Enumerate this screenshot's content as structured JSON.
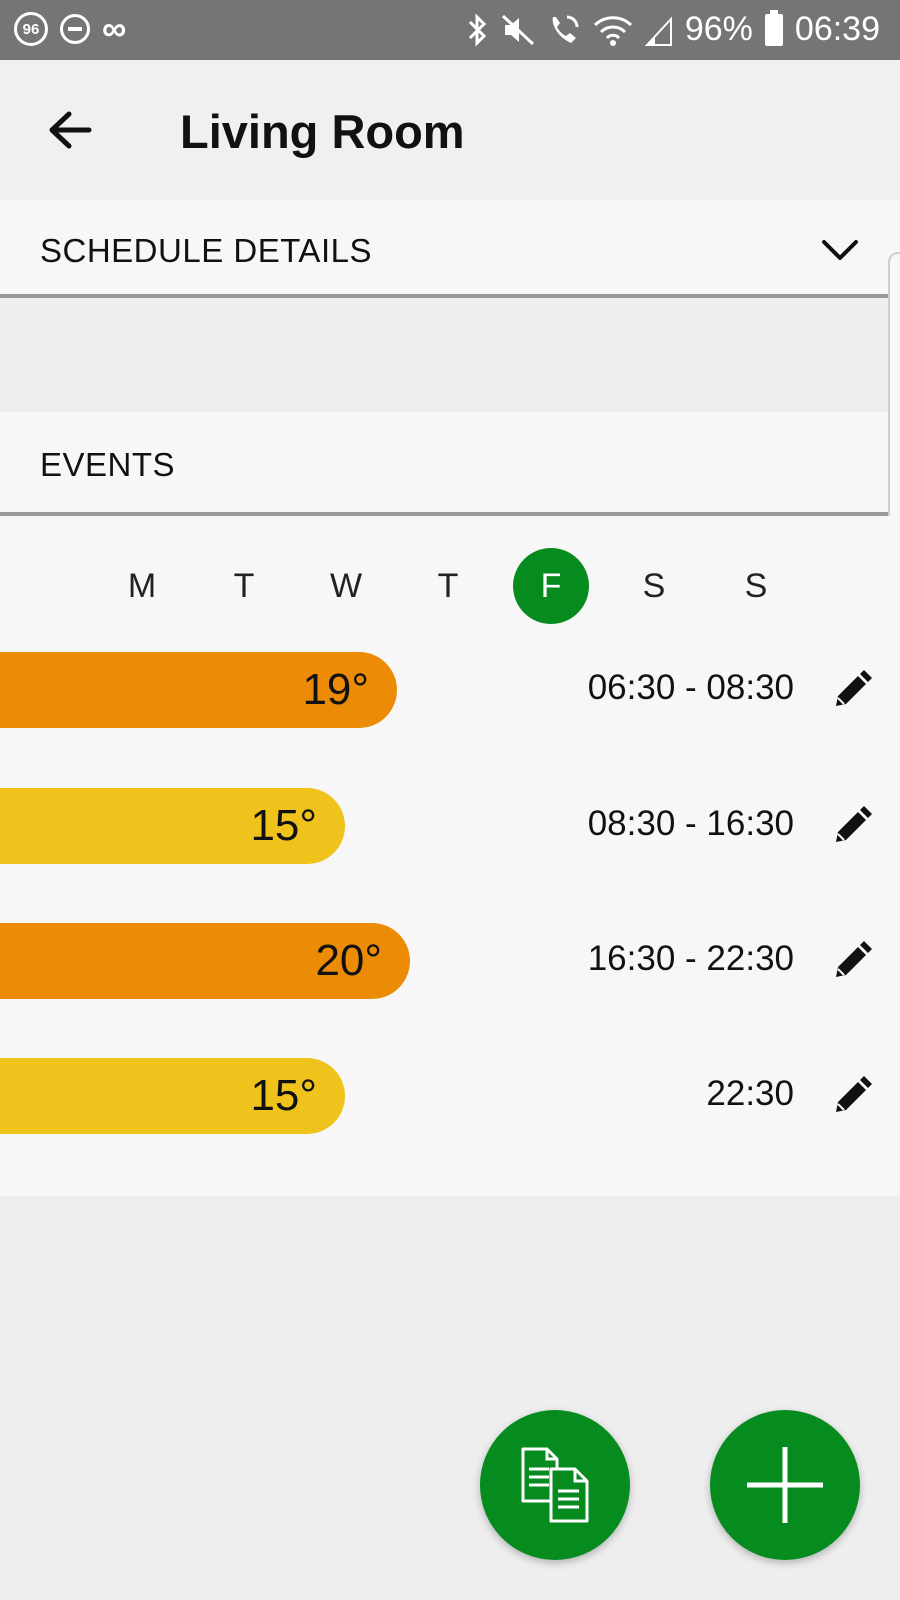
{
  "status_bar": {
    "left_badge": "96",
    "battery": "96%",
    "time": "06:39",
    "icons": [
      "badge-96-icon",
      "do-not-disturb-icon",
      "infinity-icon",
      "bluetooth-icon",
      "mute-icon",
      "wifi-calling-icon",
      "wifi-icon",
      "signal-icon",
      "battery-icon"
    ]
  },
  "header": {
    "title": "Living Room",
    "back_icon": "arrow-left-icon"
  },
  "sections": {
    "schedule_details": "SCHEDULE DETAILS",
    "events": "EVENTS"
  },
  "days": [
    {
      "label": "M",
      "selected": false
    },
    {
      "label": "T",
      "selected": false
    },
    {
      "label": "W",
      "selected": false
    },
    {
      "label": "T",
      "selected": false
    },
    {
      "label": "F",
      "selected": true
    },
    {
      "label": "S",
      "selected": false
    },
    {
      "label": "S",
      "selected": false
    }
  ],
  "events": [
    {
      "temp": "19°",
      "time": "06:30 - 08:30",
      "level": "warm"
    },
    {
      "temp": "15°",
      "time": "08:30 - 16:30",
      "level": "cool"
    },
    {
      "temp": "20°",
      "time": "16:30 - 22:30",
      "level": "warm"
    },
    {
      "temp": "15°",
      "time": "22:30",
      "level": "cool"
    }
  ],
  "colors": {
    "accent_green": "#068b1e",
    "warm_orange": "#ec8b05",
    "cool_yellow": "#f0c31c",
    "status_bar": "#757575"
  },
  "fabs": {
    "copy_icon": "copy-documents-icon",
    "add_icon": "plus-icon"
  }
}
